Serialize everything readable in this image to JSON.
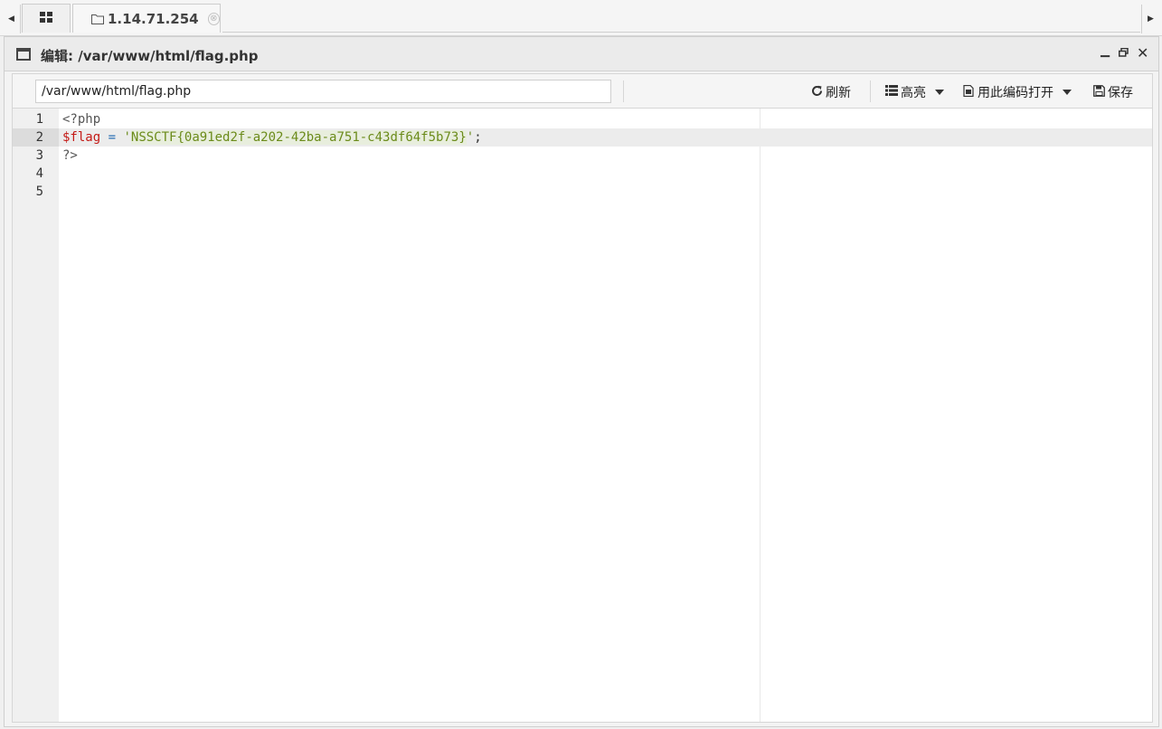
{
  "tabs": {
    "host_label": "1.14.71.254",
    "close_symbol": "⊗"
  },
  "window": {
    "title": "编辑: /var/www/html/flag.php",
    "controls": {
      "minimize": "▁",
      "maximize": "🗗",
      "close": "✕"
    }
  },
  "toolbar": {
    "path_value": "/var/www/html/flag.php",
    "refresh_label": "刷新",
    "highlight_label": "高亮",
    "encoding_label": "用此编码打开",
    "save_label": "保存"
  },
  "editor": {
    "line_numbers": [
      "1",
      "2",
      "3",
      "4",
      "5"
    ],
    "active_line": 2,
    "lines": {
      "l1": "<?php",
      "l2_var": "$flag",
      "l2_op": " = ",
      "l2_quote_open": "'",
      "l2_string": "NSSCTF{0a91ed2f-a202-42ba-a751-c43df64f5b73}",
      "l2_quote_close": "'",
      "l2_end": ";",
      "l3": "?>"
    }
  },
  "icons": {
    "tab_scroll_left": "caret-left-icon",
    "tab_scroll_right": "caret-right-icon",
    "grid": "grid-icon",
    "folder": "folder-icon",
    "window": "window-icon",
    "refresh": "refresh-icon",
    "list": "list-icon",
    "encoding": "file-encoding-icon",
    "save": "save-icon"
  }
}
